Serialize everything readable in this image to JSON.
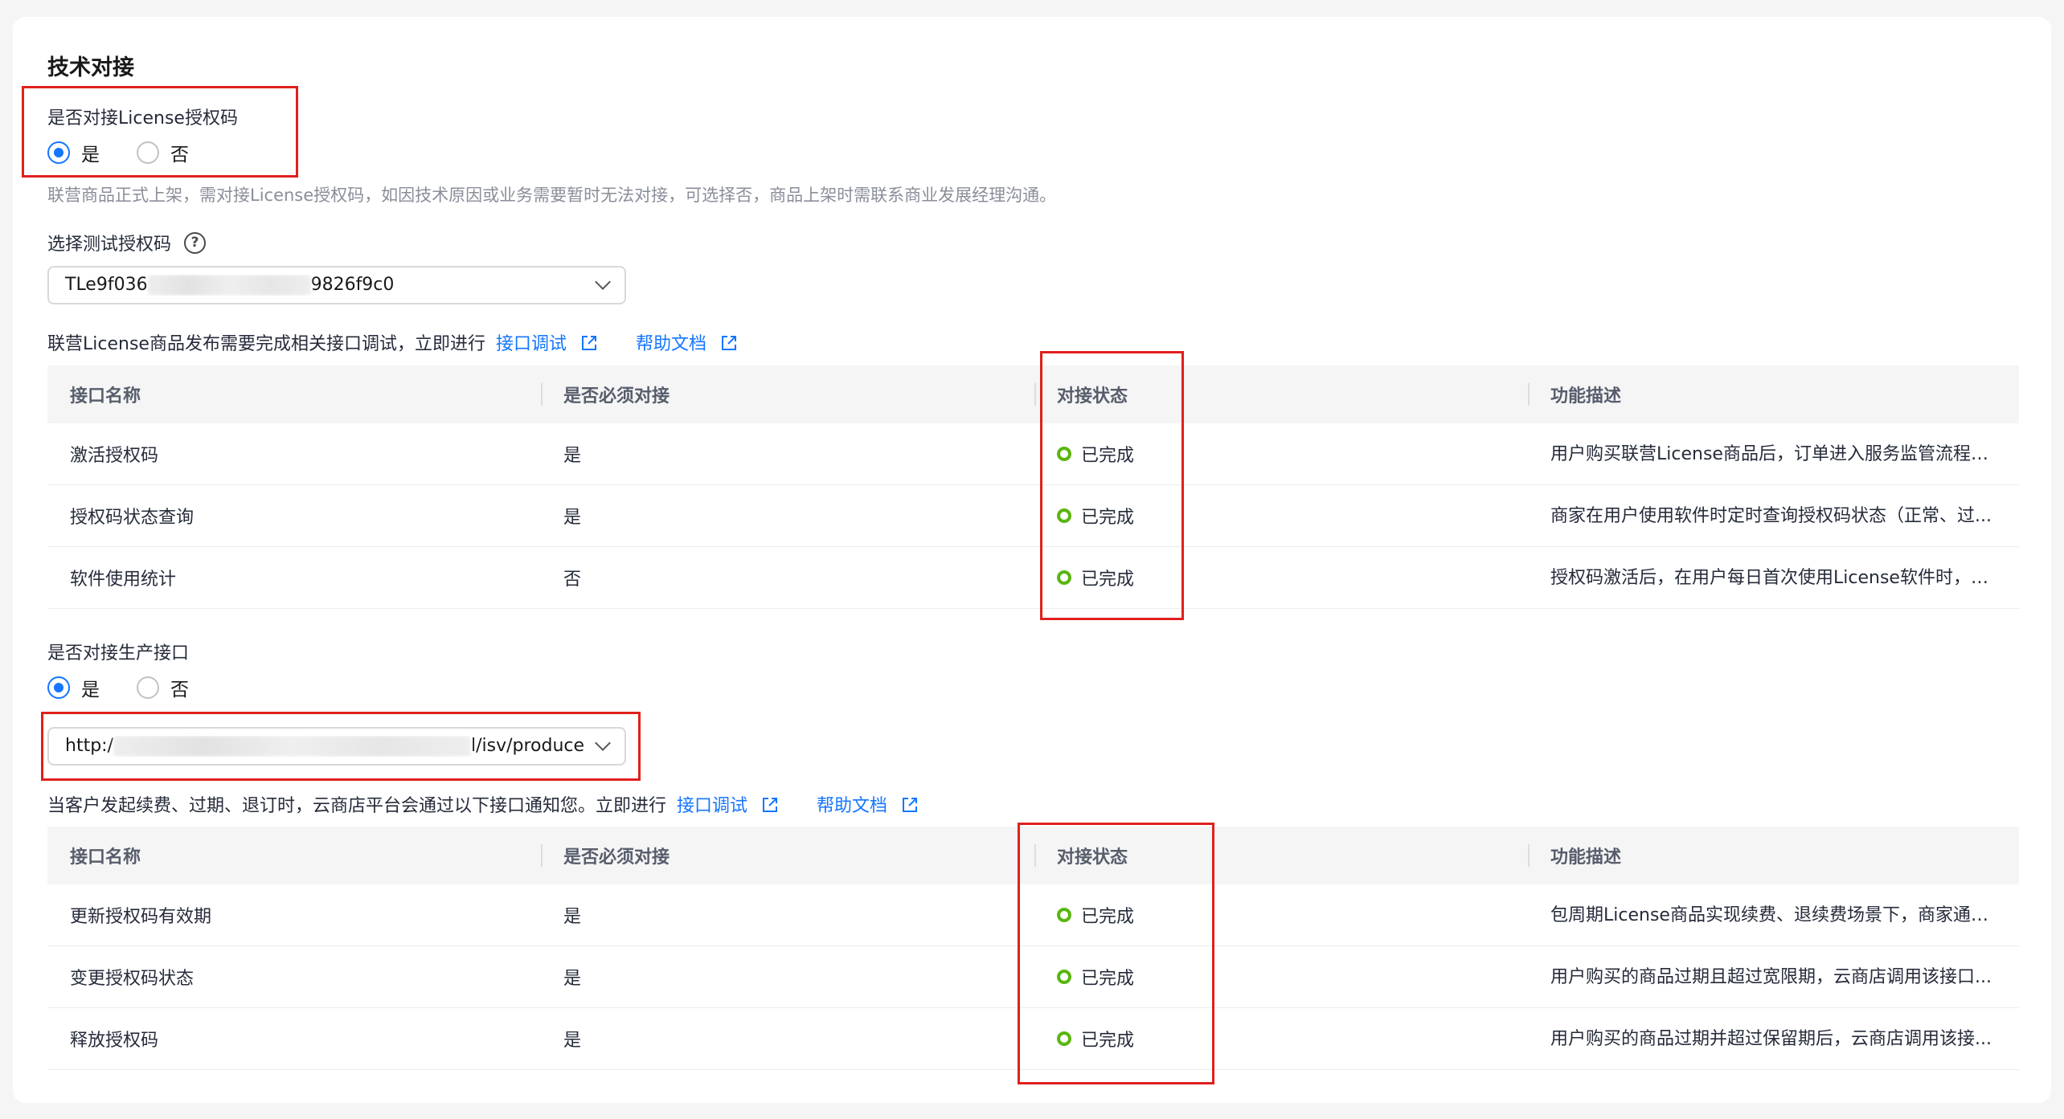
{
  "section": {
    "title": "技术对接"
  },
  "license": {
    "label": "是否对接License授权码",
    "options": {
      "yes": "是",
      "no": "否"
    },
    "selected": "yes",
    "hint": "联营商品正式上架，需对接License授权码，如因技术原因或业务需要暂时无法对接，可选择否，商品上架时需联系商业发展经理沟通。"
  },
  "test_code": {
    "label": "选择测试授权码",
    "help_icon": "question-circle-icon",
    "value_prefix": "TLe9f036",
    "value_suffix": "9826f9c0"
  },
  "test_note": {
    "text": "联营License商品发布需要完成相关接口调试，立即进行",
    "debug_link": "接口调试",
    "help_link": "帮助文档"
  },
  "table_headers": {
    "name": "接口名称",
    "required": "是否必须对接",
    "status": "对接状态",
    "desc": "功能描述"
  },
  "test_table": [
    {
      "name": "激活授权码",
      "required": "是",
      "status": "已完成",
      "desc": "用户购买联营License商品后，订单进入服务监管流程，..."
    },
    {
      "name": "授权码状态查询",
      "required": "是",
      "status": "已完成",
      "desc": "商家在用户使用软件时定时查询授权码状态（正常、过..."
    },
    {
      "name": "软件使用统计",
      "required": "否",
      "status": "已完成",
      "desc": "授权码激活后，在用户每日首次使用License软件时，上..."
    }
  ],
  "production": {
    "label": "是否对接生产接口",
    "options": {
      "yes": "是",
      "no": "否"
    },
    "selected": "yes",
    "url_prefix": "http:/",
    "url_suffix": "l/isv/produce"
  },
  "prod_note": {
    "text": "当客户发起续费、过期、退订时，云商店平台会通过以下接口通知您。立即进行",
    "debug_link": "接口调试",
    "help_link": "帮助文档"
  },
  "prod_table": [
    {
      "name": "更新授权码有效期",
      "required": "是",
      "status": "已完成",
      "desc": "包周期License商品实现续费、退续费场景下，商家通过..."
    },
    {
      "name": "变更授权码状态",
      "required": "是",
      "status": "已完成",
      "desc": "用户购买的商品过期且超过宽限期，云商店调用该接口..."
    },
    {
      "name": "释放授权码",
      "required": "是",
      "status": "已完成",
      "desc": "用户购买的商品过期并超过保留期后，云商店调用该接..."
    }
  ],
  "colors": {
    "accent": "#1476ff",
    "success": "#5ab60f",
    "highlight": "#e0201d"
  }
}
